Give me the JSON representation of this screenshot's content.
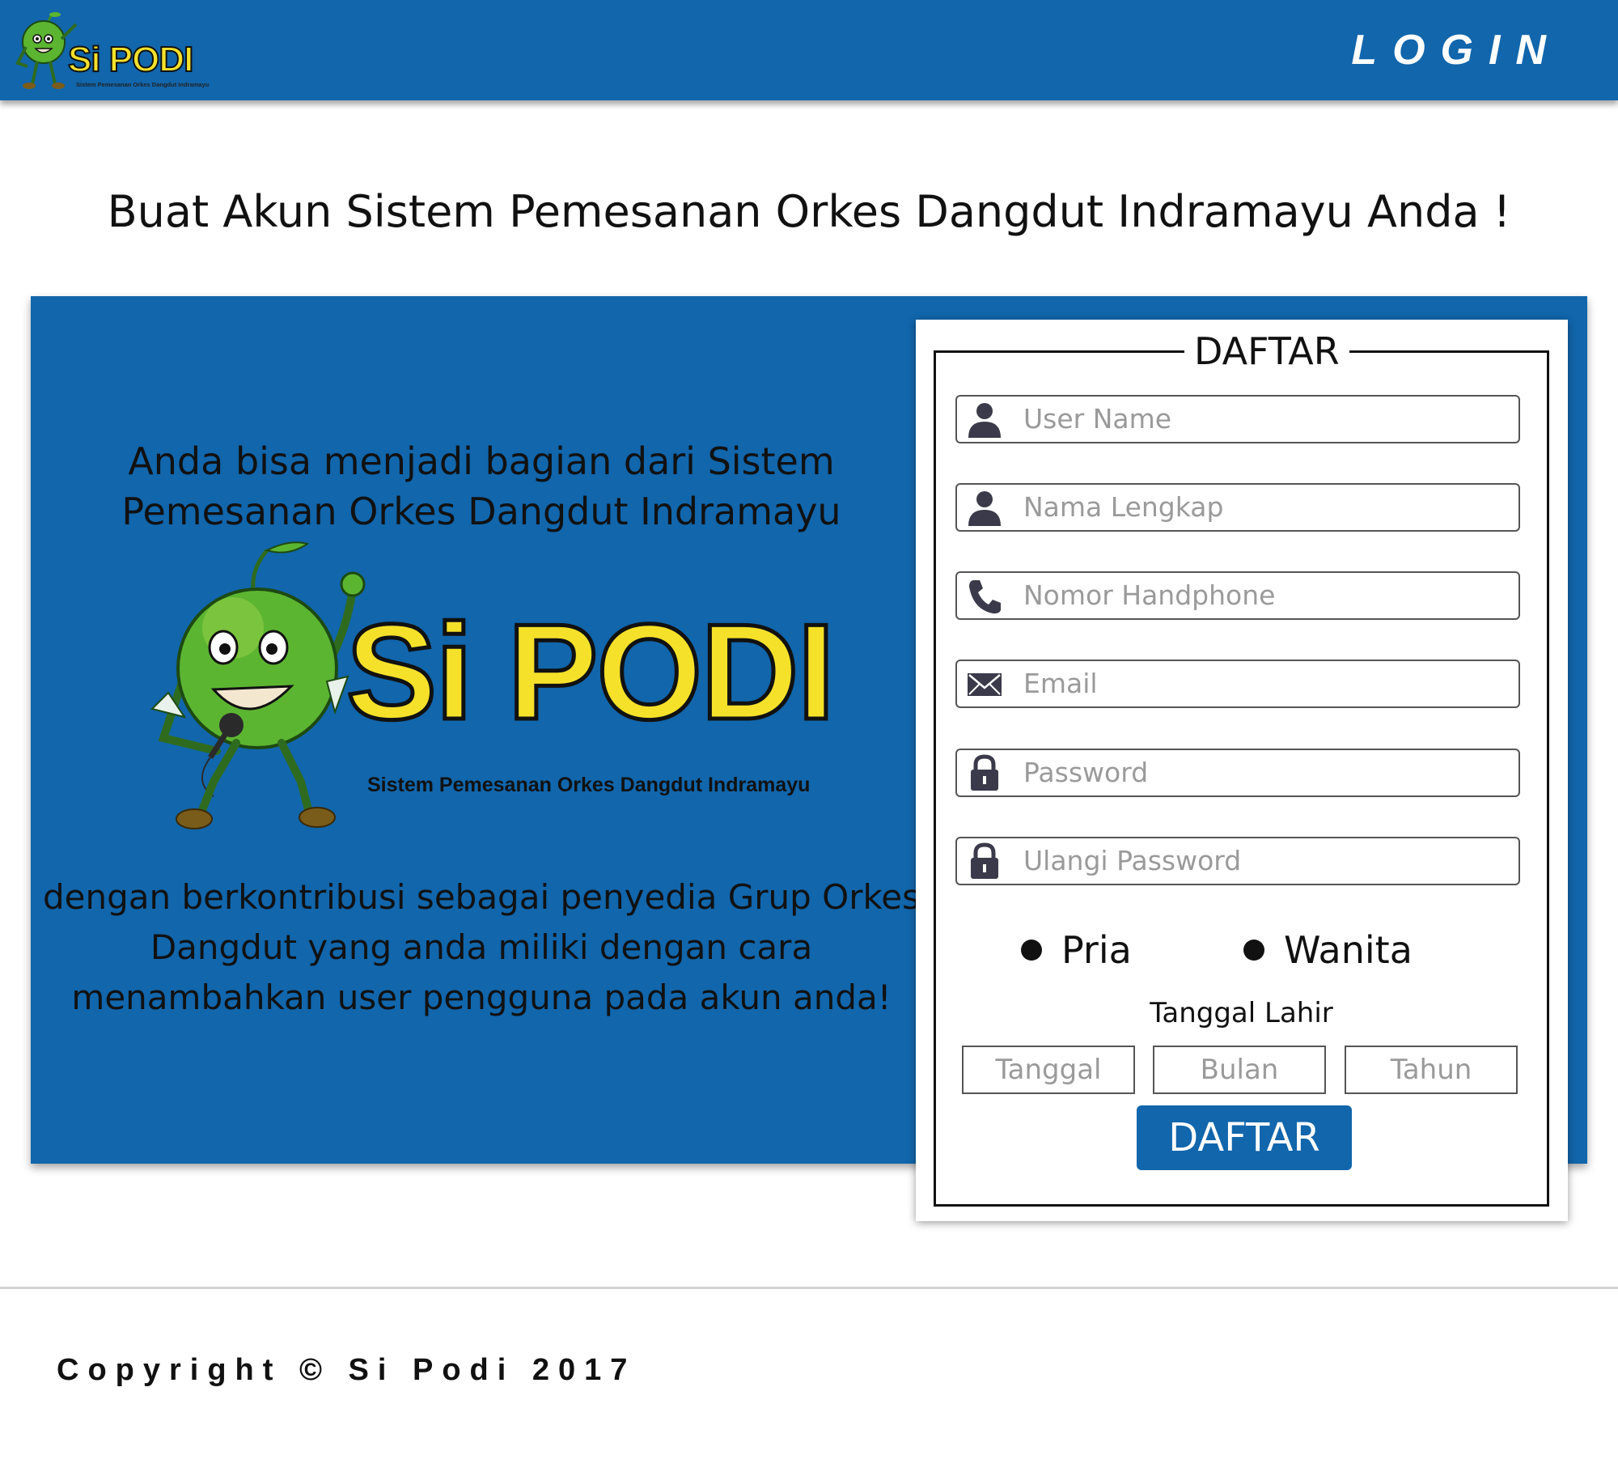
{
  "brand": {
    "name": "Si PODI",
    "tagline": "Sistem Pemesanan Orkes Dangdut Indramayu"
  },
  "header": {
    "login_label": "LOGIN"
  },
  "page": {
    "title": "Buat Akun Sistem Pemesanan Orkes Dangdut Indramayu Anda !"
  },
  "hero": {
    "top_text": "Anda bisa menjadi bagian dari Sistem Pemesanan Orkes Dangdut Indramayu",
    "bottom_text": "dengan berkontribusi sebagai penyedia Grup Orkes Dangdut yang anda miliki dengan cara menambahkan user pengguna pada akun anda!"
  },
  "form": {
    "legend": "DAFTAR",
    "fields": {
      "username": {
        "placeholder": "User Name",
        "icon": "user-icon"
      },
      "fullname": {
        "placeholder": "Nama Lengkap",
        "icon": "user-icon"
      },
      "phone": {
        "placeholder": "Nomor Handphone",
        "icon": "phone-icon"
      },
      "email": {
        "placeholder": "Email",
        "icon": "envelope-icon"
      },
      "password": {
        "placeholder": "Password",
        "icon": "lock-icon"
      },
      "password_confirm": {
        "placeholder": "Ulangi Password",
        "icon": "lock-icon"
      }
    },
    "gender": {
      "male": "Pria",
      "female": "Wanita"
    },
    "dob": {
      "label": "Tanggal Lahir",
      "day_placeholder": "Tanggal",
      "month_placeholder": "Bulan",
      "year_placeholder": "Tahun"
    },
    "submit_label": "DAFTAR"
  },
  "footer": {
    "copyright": "Copyright © Si Podi 2017"
  },
  "colors": {
    "primary": "#1166ac",
    "brand_yellow": "#f5e12a",
    "mascot_green": "#5cb531"
  }
}
